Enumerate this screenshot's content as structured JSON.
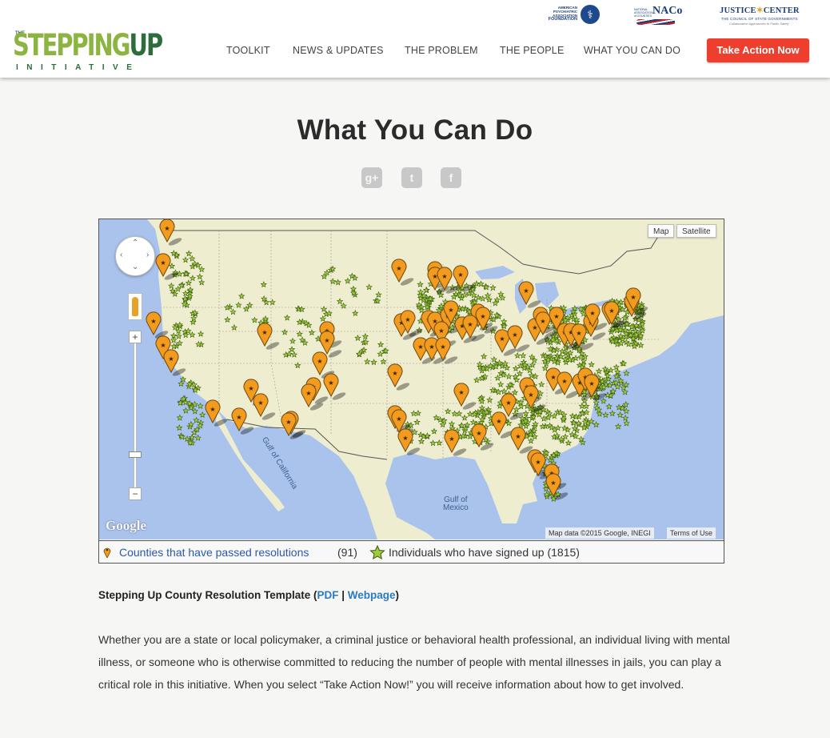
{
  "header": {
    "logo": {
      "small": "THE",
      "word_a": "STEPPING",
      "word_b": "UP",
      "sub": "INITIATIVE"
    },
    "partners": {
      "apa": {
        "line1": "AMERICAN",
        "line2": "PSYCHIATRIC",
        "line3": "ASSOCIATION",
        "line4": "FOUNDATION"
      },
      "naco": {
        "small": "NATIONAL ASSOCIATION of COUNTIES",
        "name": "NACo"
      },
      "justice": {
        "name": "JUSTICE",
        "name2": "CENTER",
        "line2": "THE COUNCIL OF STATE GOVERNMENTS",
        "line3": "Collaborative Approaches to Public Safety"
      }
    },
    "nav": [
      "TOOLKIT",
      "NEWS & UPDATES",
      "THE PROBLEM",
      "THE PEOPLE",
      "WHAT YOU CAN DO"
    ],
    "cta_label": "Take Action Now",
    "cta_color": "#ee3f2e"
  },
  "page_title": "What You Can Do",
  "social": {
    "icons": [
      "google-plus-icon",
      "twitter-icon",
      "facebook-icon"
    ],
    "glyphs": [
      "g+",
      "t",
      "f"
    ]
  },
  "map": {
    "type_buttons": {
      "map": "Map",
      "satellite": "Satellite"
    },
    "zoom_in": "+",
    "zoom_out": "−",
    "brand": "Google",
    "attribution": "Map data ©2015 Google, INEGI",
    "terms": "Terms of Use",
    "labels": {
      "gulf_california": "Gulf of California",
      "gulf_mexico_1": "Gulf of",
      "gulf_mexico_2": "Mexico"
    },
    "colors": {
      "water": "#a9c3ed",
      "land": "#efedd0",
      "pin": "#f29b1e",
      "star": "#9ccc3c"
    }
  },
  "legend": {
    "counties_link": "Counties that have passed resolutions",
    "counties_count": "(91)",
    "individuals": "Individuals who have signed up (1815)"
  },
  "template": {
    "label": "Stepping Up County Resolution Template (",
    "pdf": "PDF",
    "sep": " | ",
    "webpage": "Webpage",
    "close": ")"
  },
  "paragraph": "Whether you are a state or local policymaker, a criminal justice or behavioral health professional, an individual living with mental illness, or someone who is otherwise committed to reducing the number of people with mental illnesses in jails, you can play a critical role in this initiative. When you select “Take Action Now!” you will receive information about how to get involved."
}
